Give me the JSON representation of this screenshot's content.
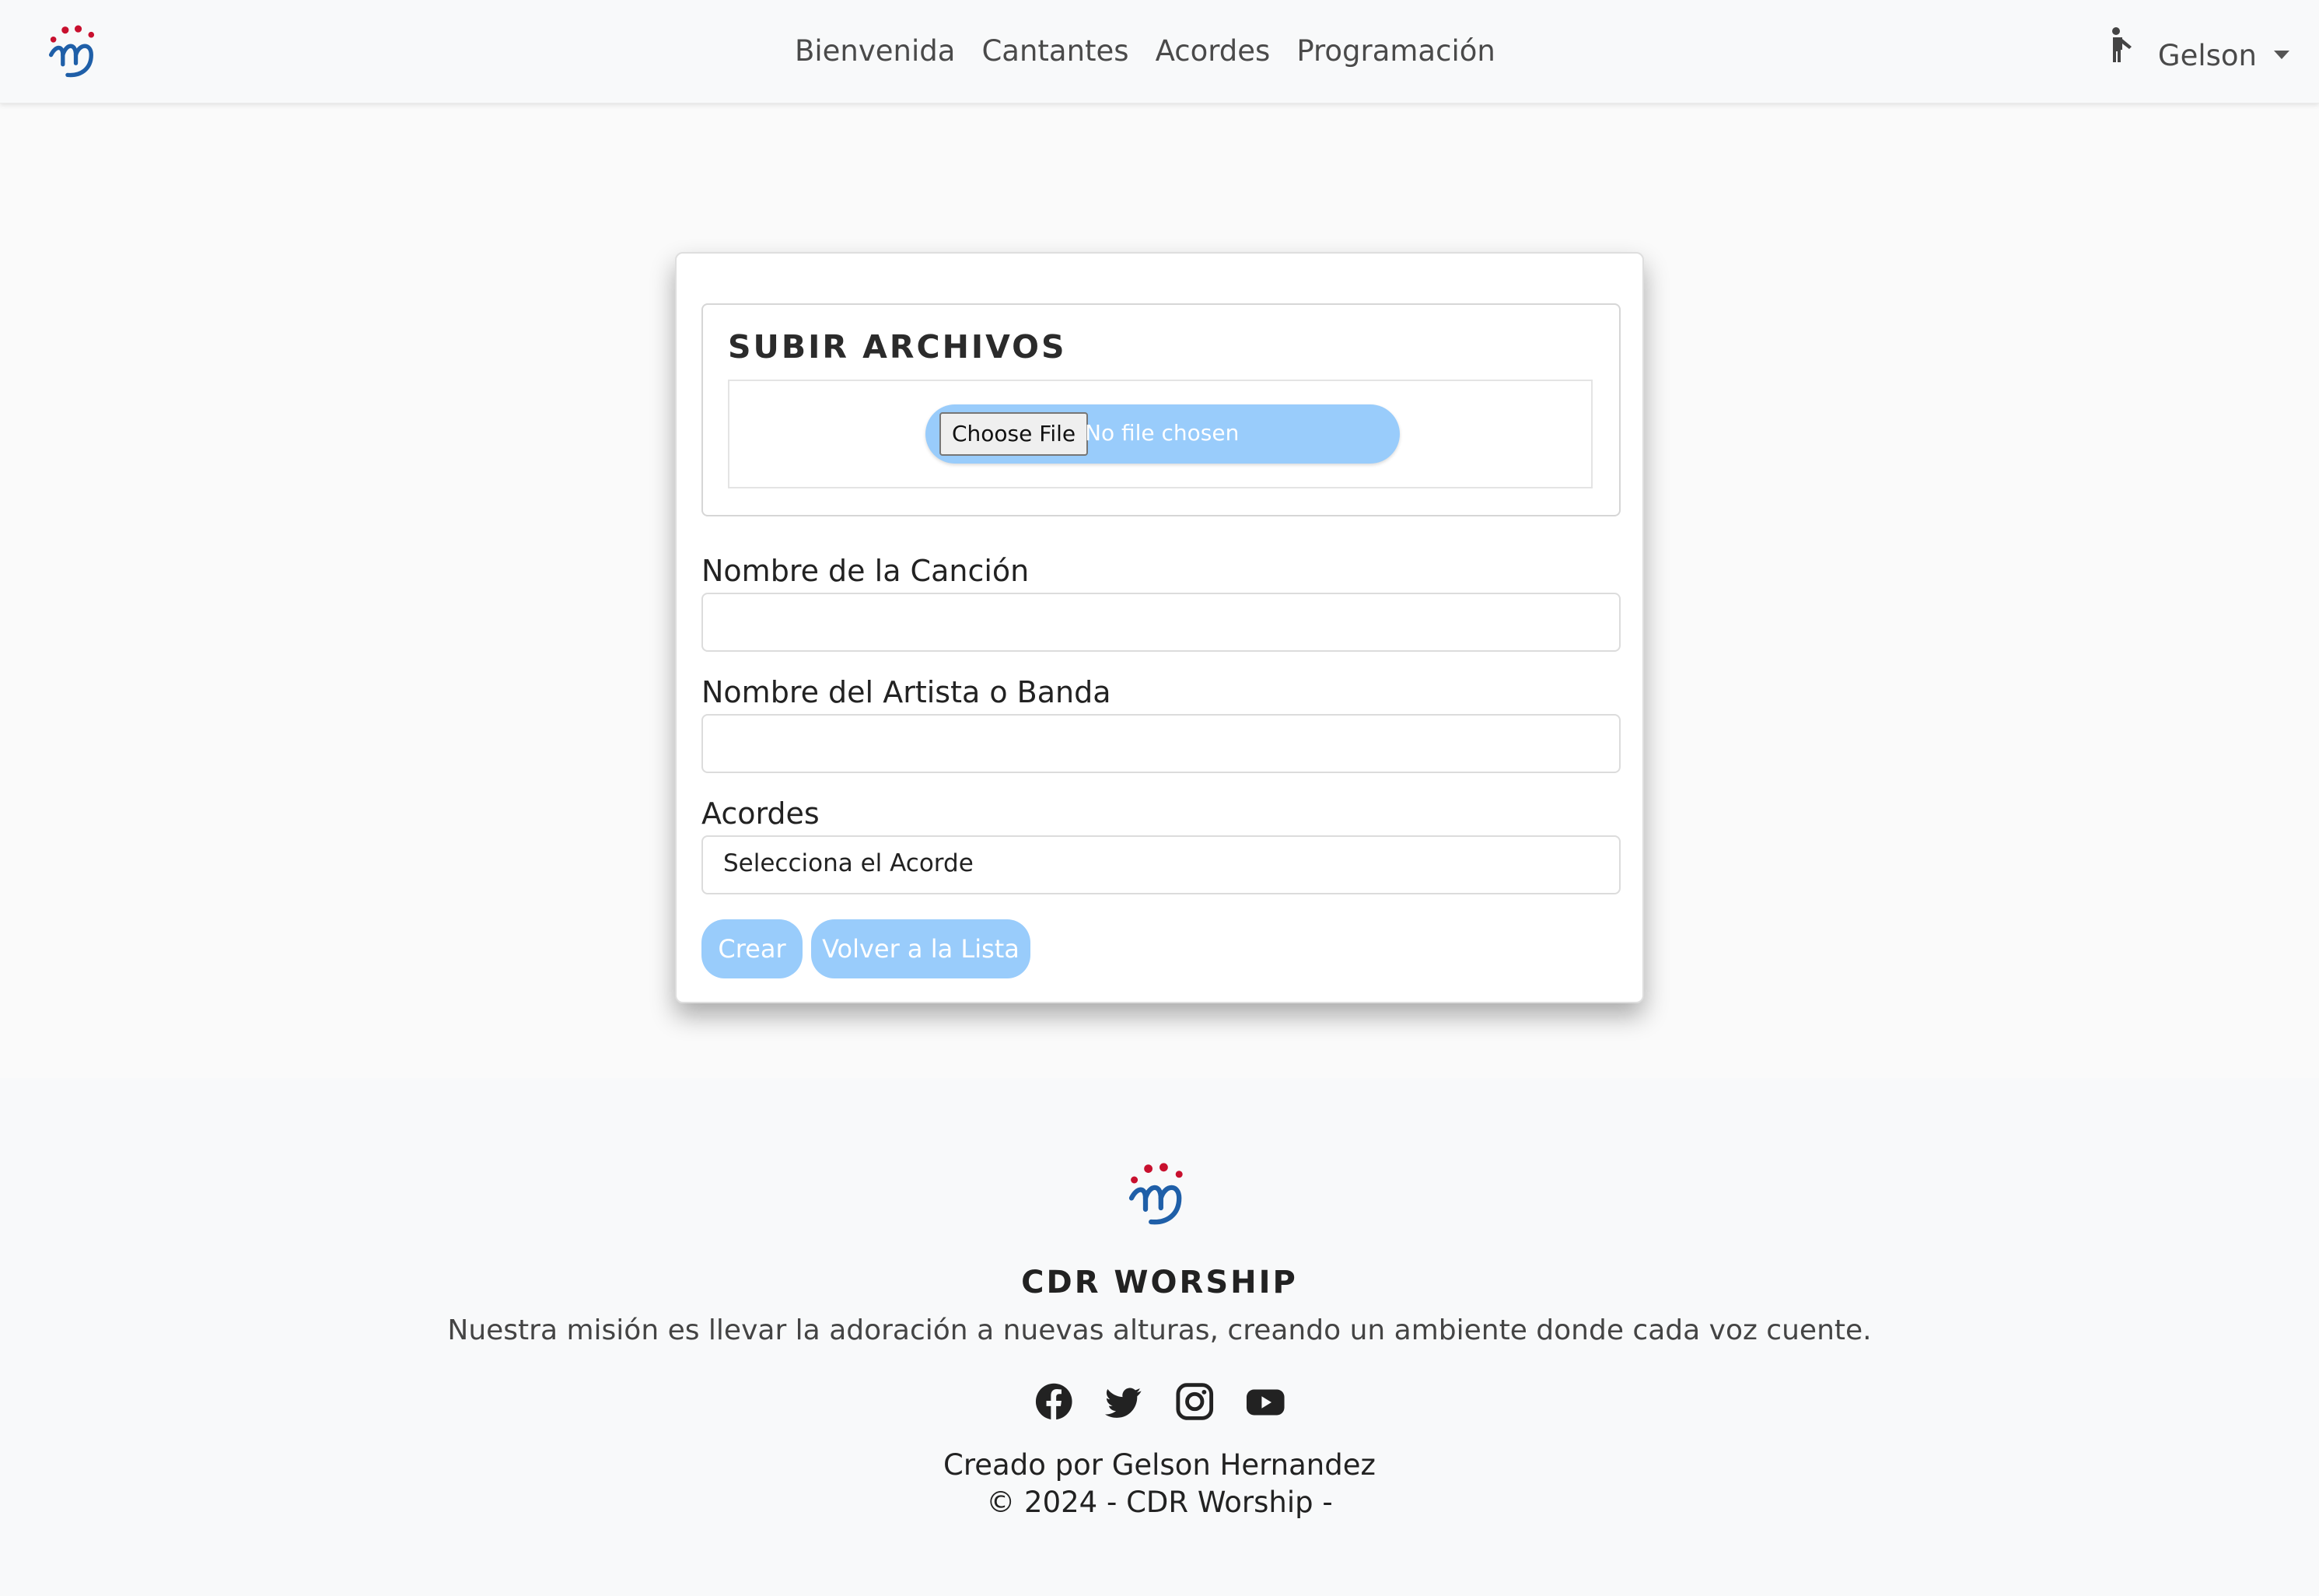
{
  "colors": {
    "accent_button": "#99ccfb",
    "logo_red": "#c8102e",
    "logo_blue": "#1f5fa8",
    "navbar_bg": "#f8f9fa"
  },
  "header": {
    "logo_icon": "cdr-worship-logo-icon",
    "nav": [
      "Bienvenida",
      "Cantantes",
      "Acordes",
      "Programación"
    ],
    "user": {
      "icon": "person-icon",
      "name": "Gelson",
      "dropdown_icon": "caret-down-icon"
    }
  },
  "form": {
    "upload_title": "SUBIR ARCHIVOS",
    "file_button": "Choose File",
    "file_status": "No file chosen",
    "song_label": "Nombre de la Canción",
    "song_value": "",
    "artist_label": "Nombre del Artista o Banda",
    "artist_value": "",
    "chords_label": "Acordes",
    "chords_selected": "Selecciona el Acorde",
    "create_button": "Crear",
    "back_button": "Volver a la Lista"
  },
  "footer": {
    "logo_icon": "cdr-worship-logo-icon",
    "title": "CDR WORSHIP",
    "mission": "Nuestra misión es llevar la adoración a nuevas alturas, creando un ambiente donde cada voz cuente.",
    "social": [
      "facebook-icon",
      "twitter-icon",
      "instagram-icon",
      "youtube-icon"
    ],
    "credit": "Creado por Gelson Hernandez",
    "copyright": "© 2024 - CDR Worship -"
  }
}
